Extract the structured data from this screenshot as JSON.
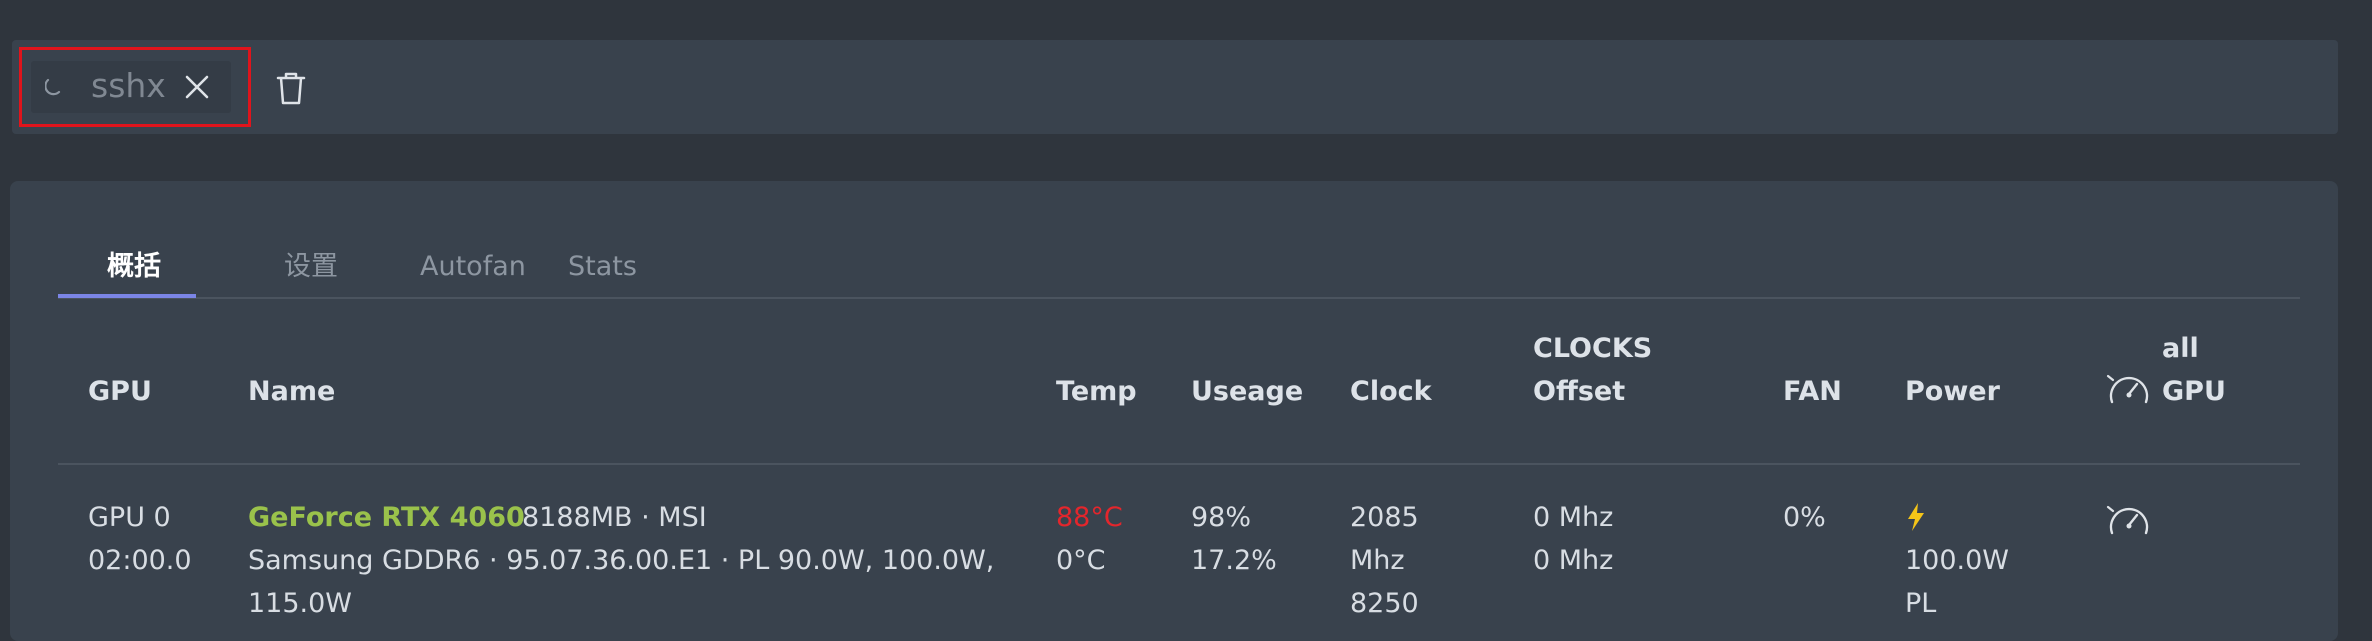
{
  "connection_chip": {
    "label": "sshx",
    "status_icon": "loading-spinner-icon",
    "close_icon": "close-icon"
  },
  "toolbar": {
    "delete_icon": "trash-icon"
  },
  "tabs": [
    {
      "label": "概括",
      "active": true
    },
    {
      "label": "设置",
      "active": false
    },
    {
      "label": "Autofan",
      "active": false
    },
    {
      "label": "Stats",
      "active": false
    }
  ],
  "table": {
    "headers": {
      "gpu": "GPU",
      "name": "Name",
      "temp": "Temp",
      "useage": "Useage",
      "clock": "Clock",
      "clocks_offset_line1": "CLOCKS",
      "clocks_offset_line2": "Offset",
      "fan": "FAN",
      "power": "Power",
      "all_gpu_line1": "all",
      "all_gpu_line2": "GPU",
      "all_gpu_icon": "gauge-icon"
    },
    "rows": [
      {
        "gpu_id": "GPU 0",
        "bus_id": "02:00.0",
        "model": "GeForce RTX 4060",
        "memory_vendor": "8188MB · MSI",
        "details_line1": "Samsung GDDR6 · 95.07.36.00.E1 · PL 90.0W, 100.0W,",
        "details_line2": "115.0W",
        "temp_core": "88°C",
        "temp_mem": "0°C",
        "useage_gpu": "98%",
        "useage_mem": "17.2%",
        "clock_core": "2085",
        "clock_unit": "Mhz",
        "clock_mem": "8250",
        "offset_core": "0 Mhz",
        "offset_mem": "0 Mhz",
        "fan": "0%",
        "power_icon": "lightning-icon",
        "power_value": "100.0W",
        "power_pl": "PL",
        "row_icon": "gauge-icon"
      }
    ]
  },
  "colors": {
    "background": "#2f353d",
    "panel": "#39424d",
    "accent_tab": "#7b85e6",
    "gpu_model": "#9ac24b",
    "temp_hot": "#e3262c",
    "highlight_box": "#e0141c"
  }
}
